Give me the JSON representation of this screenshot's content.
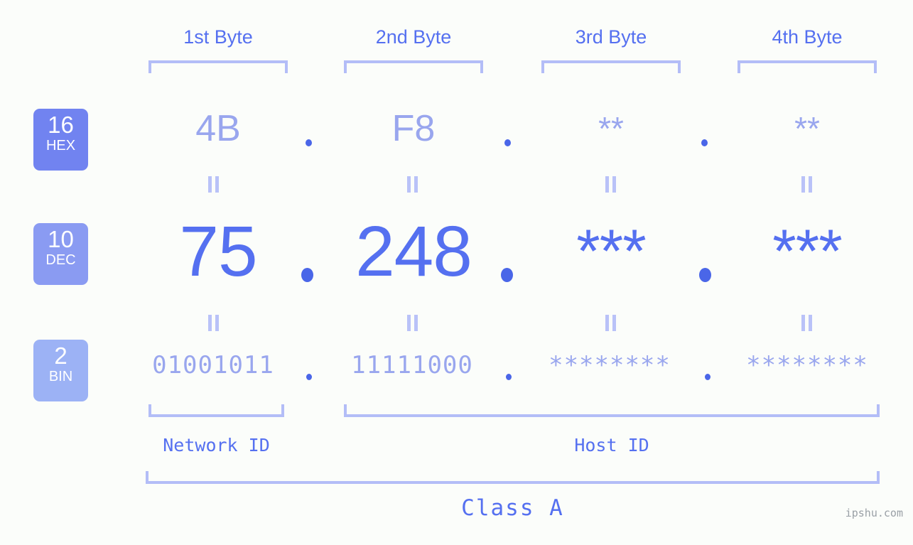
{
  "meta": {
    "background_color": "#fbfdfa",
    "accent_strong": "#5570f0",
    "accent_light": "#99a6ee",
    "bracket_color": "#b3bdf7"
  },
  "header": {
    "byte_labels": [
      "1st Byte",
      "2nd Byte",
      "3rd Byte",
      "4th Byte"
    ]
  },
  "bases": [
    {
      "num": "16",
      "name": "HEX",
      "color": "#7183f0"
    },
    {
      "num": "10",
      "name": "DEC",
      "color": "#8a9bf2"
    },
    {
      "num": "2",
      "name": "BIN",
      "color": "#9cb2f5"
    }
  ],
  "rows": {
    "hex": {
      "base": "16",
      "values": [
        "4B",
        "F8",
        "**",
        "**"
      ]
    },
    "dec": {
      "base": "10",
      "values": [
        "75",
        "248",
        "***",
        "***"
      ]
    },
    "bin": {
      "base": "2",
      "values": [
        "01001011",
        "11111000",
        "********",
        "********"
      ]
    }
  },
  "separators": {
    "dot": ".",
    "equals_mark": "||"
  },
  "footer": {
    "network_id_label": "Network ID",
    "host_id_label": "Host ID",
    "class_label": "Class A",
    "watermark": "ipshu.com"
  }
}
